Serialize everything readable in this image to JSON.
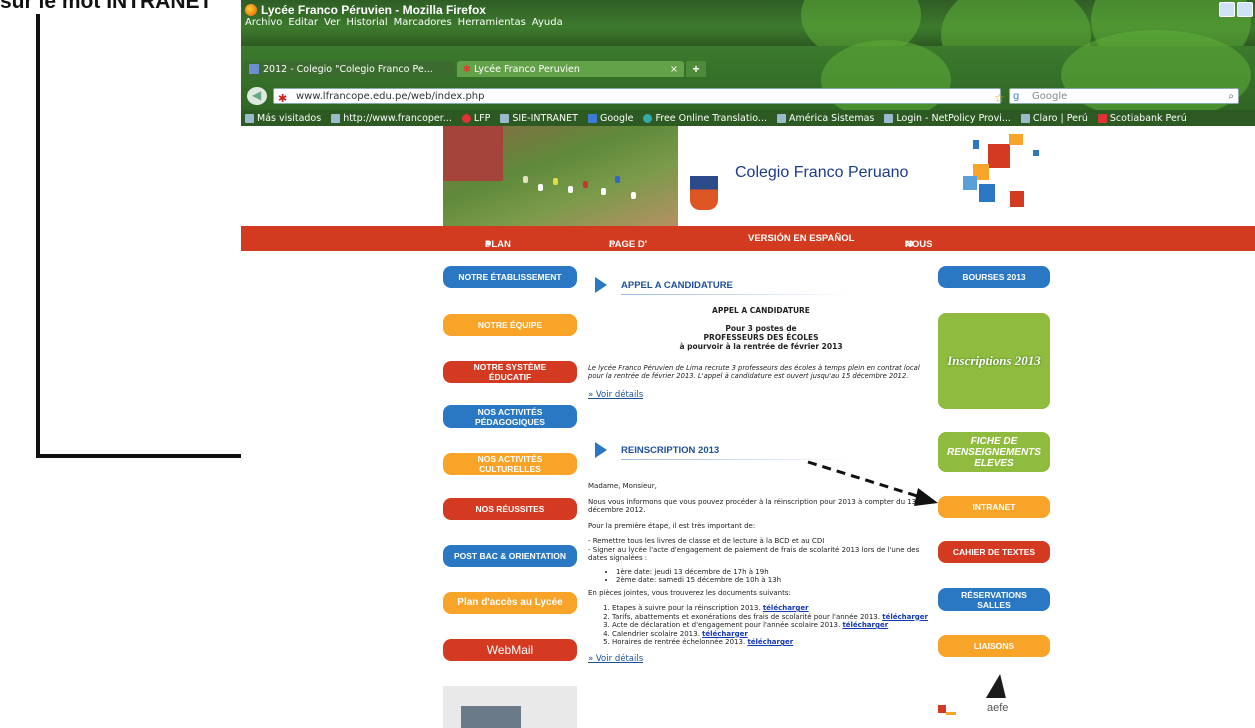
{
  "annotation": {
    "caption": "sur le mot INTRANET"
  },
  "window": {
    "title": "Lycée Franco Péruvien - Mozilla Firefox"
  },
  "menu": [
    "Archivo",
    "Editar",
    "Ver",
    "Historial",
    "Marcadores",
    "Herramientas",
    "Ayuda"
  ],
  "tabs": [
    {
      "label": "2012 - Colegio \"Colegio Franco Pe..."
    },
    {
      "label": "Lycée Franco Peruvien",
      "close": "×"
    }
  ],
  "newtab": "+",
  "address": {
    "url": "www.lfrancope.edu.pe/web/index.php"
  },
  "search": {
    "placeholder": "Google"
  },
  "bookmarks": [
    "Más visitados",
    "http://www.francoper...",
    "LFP",
    "SIE-INTRANET",
    "Google",
    "Free Online Translatio...",
    "América Sistemas",
    "Login - NetPolicy Provi...",
    "Claro | Perú",
    "Scotiabank Perú"
  ],
  "site": {
    "name": "Colegio Franco Peruano",
    "nav": [
      "PLAN DU SITE",
      "PAGE D' ACCUEIL",
      "VERSIÓN EN ESPAÑOL",
      "NOUS CONTACTER"
    ],
    "left_buttons": [
      "NOTRE ÉTABLISSEMENT",
      "NOTRE ÉQUIPE",
      "NOTRE SYSTÈME ÉDUCATIF",
      "NOS ACTIVITÉS PÉDAGOGIQUES",
      "NOS ACTIVITÉS CULTURELLES",
      "NOS RÉUSSITES",
      "POST BAC & ORIENTATION",
      "Plan d'accès au Lycée",
      "WebMail"
    ],
    "right_buttons": [
      "BOURSES 2013",
      "Inscriptions 2013",
      "FICHE DE RENSEIGNEMENTS ELEVES",
      "INTRANET",
      "CAHIER DE TEXTES",
      "RÉSERVATIONS SALLES",
      "LIAISONS"
    ],
    "aefe_logo": "aefe",
    "news": [
      {
        "title": "APPEL A CANDIDATURE",
        "subhead": "APPEL A CANDIDATURE",
        "posts": "Pour 3 postes de",
        "role": "PROFESSEURS DES ÉCOLES",
        "when": "à pourvoir à la rentrée de février 2013",
        "body": "Le lycée Franco Péruvien de Lima recrute 3 professeurs des écoles à temps plein en contrat local pour la rentrée de février 2013. L'appel à candidature est ouvert jusqu'au 15 décembre 2012.",
        "more": "» Voir détails"
      },
      {
        "title": "REINSCRIPTION 2013",
        "greeting": "Madame, Monsieur,",
        "p1": "Nous vous informons que vous pouvez procéder à la réinscription pour 2013 à compter du 13 décembre 2012.",
        "p2": "Pour la première étape, il est très important de:",
        "p3a": "- Remettre tous les livres de classe et de lecture à la BCD et au CDI",
        "p3b": "- Signer au lycée l'acte d'engagement de paiement de frais de scolarité 2013 lors de l'une des dates signalées :",
        "dates": [
          "1ère date: jeudi 13 décembre de 17h à 19h",
          "2ème date: samedi 15 décembre de 10h à 13h"
        ],
        "p4": "En pièces jointes, vous trouverez les documents suivants:",
        "docs": [
          {
            "text": "Etapes à suivre pour la réinscription 2013.",
            "link": "télécharger"
          },
          {
            "text": "Tarifs, abattements et exonérations des frais de scolarité pour l'année 2013.",
            "link": "télécharger"
          },
          {
            "text": "Acte de déclaration et d'engagement pour l'année scolaire 2013.",
            "link": "télécharger"
          },
          {
            "text": "Calendrier scolaire 2013.",
            "link": "télécharger"
          },
          {
            "text": "Horaires de rentrée échelonnée 2013.",
            "link": "télécharger"
          }
        ],
        "more": "» Voir détails"
      }
    ]
  }
}
